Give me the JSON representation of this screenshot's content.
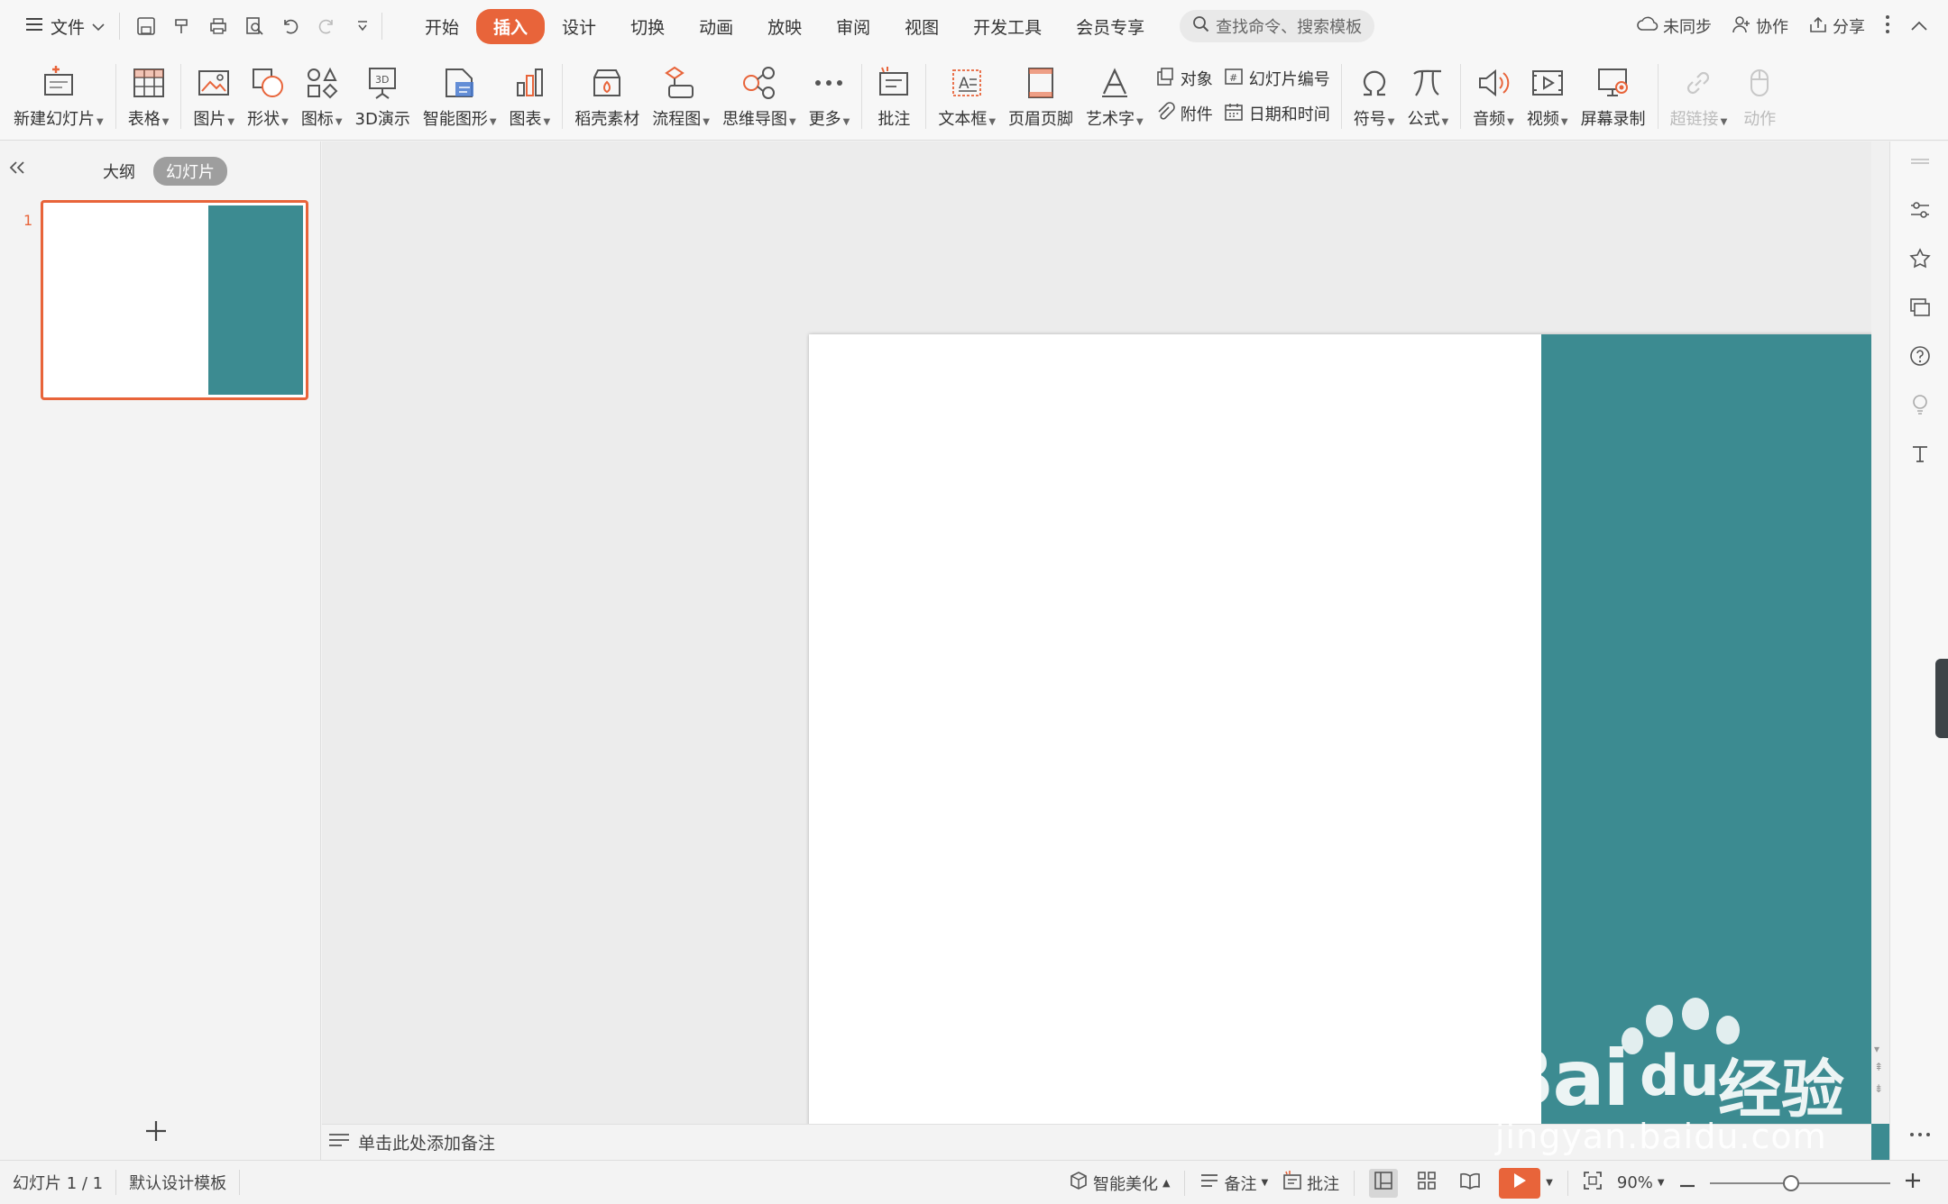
{
  "menubar": {
    "file_label": "文件",
    "tabs": [
      {
        "label": "开始",
        "active": false
      },
      {
        "label": "插入",
        "active": true
      },
      {
        "label": "设计",
        "active": false
      },
      {
        "label": "切换",
        "active": false
      },
      {
        "label": "动画",
        "active": false
      },
      {
        "label": "放映",
        "active": false
      },
      {
        "label": "审阅",
        "active": false
      },
      {
        "label": "视图",
        "active": false
      },
      {
        "label": "开发工具",
        "active": false
      },
      {
        "label": "会员专享",
        "active": false
      }
    ],
    "search_placeholder": "查找命令、搜索模板",
    "sync_label": "未同步",
    "collab_label": "协作",
    "share_label": "分享"
  },
  "ribbon": {
    "new_slide": "新建幻灯片",
    "table": "表格",
    "picture": "图片",
    "shape": "形状",
    "icon": "图标",
    "demo3d": "3D演示",
    "smartart": "智能图形",
    "chart": "图表",
    "material": "稻壳素材",
    "flowchart": "流程图",
    "mindmap": "思维导图",
    "more": "更多",
    "comment": "批注",
    "textbox": "文本框",
    "header_footer": "页眉页脚",
    "wordart": "艺术字",
    "object": "对象",
    "slide_number": "幻灯片编号",
    "attachment": "附件",
    "datetime": "日期和时间",
    "symbol": "符号",
    "formula": "公式",
    "audio": "音频",
    "video": "视频",
    "screen_record": "屏幕录制",
    "hyperlink": "超链接",
    "action": "动作"
  },
  "left_panel": {
    "outline_tab": "大纲",
    "slides_tab": "幻灯片",
    "slide_number": "1"
  },
  "slide": {
    "panel_color": "#3c8b91",
    "background": "#ffffff"
  },
  "notes": {
    "placeholder": "单击此处添加备注"
  },
  "status": {
    "slide_info": "幻灯片 1 / 1",
    "template": "默认设计模板",
    "beautify": "智能美化",
    "notes": "备注",
    "comments": "批注",
    "zoom": "90%",
    "zoom_level": 0.45
  },
  "watermark": {
    "brand": "Bai",
    "brand_du": "du",
    "brand_cn": "经验",
    "url": "jingyan.baidu.com"
  },
  "colors": {
    "accent": "#e8643a",
    "teal": "#3c8b91"
  }
}
